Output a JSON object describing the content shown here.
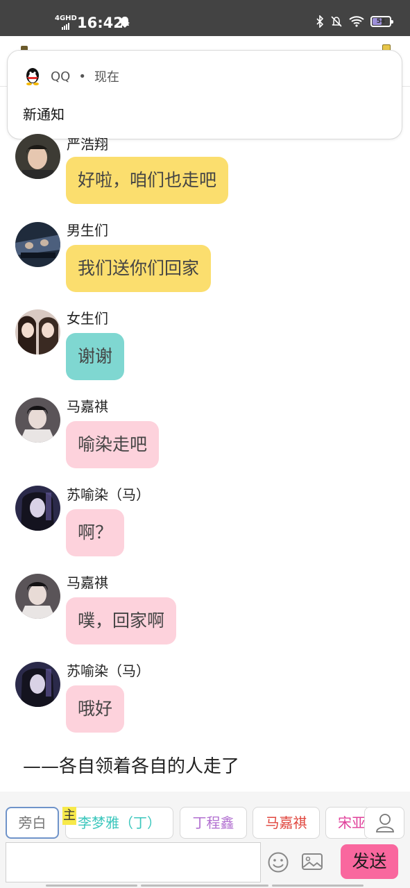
{
  "status_bar": {
    "network": "4GHD",
    "time": "16:42",
    "battery": "54",
    "battery_level": 0.54
  },
  "notification": {
    "app_name": "QQ",
    "separator": "•",
    "time": "现在",
    "body": "新通知"
  },
  "messages": [
    {
      "sender": "严浩翔",
      "text": "好啦，咱们也走吧",
      "bubble_color": "#fbde6e"
    },
    {
      "sender": "男生们",
      "text": "我们送你们回家",
      "bubble_color": "#fbde6e"
    },
    {
      "sender": "女生们",
      "text": "谢谢",
      "bubble_color": "#7fd7d1"
    },
    {
      "sender": "马嘉祺",
      "text": "喻染走吧",
      "bubble_color": "#fdd2dc"
    },
    {
      "sender": "苏喻染（马）",
      "text": "啊？",
      "bubble_color": "#fdd2dc"
    },
    {
      "sender": "马嘉祺",
      "text": "噗，回家啊",
      "bubble_color": "#fdd2dc"
    },
    {
      "sender": "苏喻染（马）",
      "text": "哦好",
      "bubble_color": "#fdd2dc"
    }
  ],
  "narration": "——各自领着各自的人走了",
  "role_chips": [
    {
      "label": "旁白",
      "color": "#777777",
      "selected": true
    },
    {
      "label": "李梦雅（丁）",
      "color": "#3cc7bd",
      "selected": false
    },
    {
      "label": "丁程鑫",
      "color": "#b16fd0",
      "selected": false
    },
    {
      "label": "马嘉祺",
      "color": "#e0463e",
      "selected": false
    },
    {
      "label": "宋亚",
      "color": "#e0409a",
      "selected": false
    }
  ],
  "host_tag": "主",
  "send_label": "发送",
  "icons": {
    "user": "person-icon",
    "emoji": "smiley-icon",
    "image": "image-icon",
    "qq": "qq-penguin-icon"
  }
}
